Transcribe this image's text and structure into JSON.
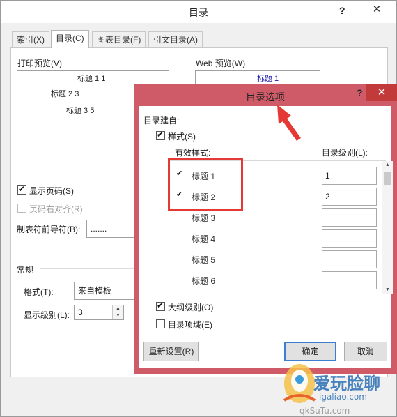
{
  "outer_dialog": {
    "title": "目录",
    "help_label": "?",
    "close_label": "✕",
    "tabs": [
      {
        "label": "索引(X)"
      },
      {
        "label": "目录(C)"
      },
      {
        "label": "图表目录(F)"
      },
      {
        "label": "引文目录(A)"
      }
    ],
    "print_preview": {
      "label": "打印预览(V)",
      "lines": [
        "标题 1 1",
        "标题 2 3",
        "标题 3 5"
      ]
    },
    "web_preview": {
      "label": "Web 预览(W)",
      "lines": [
        "标题 1"
      ]
    },
    "show_page_numbers": {
      "label": "显示页码(S)",
      "checked": true
    },
    "right_align": {
      "label": "页码右对齐(R)",
      "checked": false
    },
    "tab_leader": {
      "label": "制表符前导符(B):",
      "value": "......."
    },
    "general": {
      "heading": "常规",
      "format_label": "格式(T):",
      "format_value": "来自模板",
      "levels_label": "显示级别(L):",
      "levels_value": "3"
    }
  },
  "options_dialog": {
    "title": "目录选项",
    "help_label": "?",
    "close_label": "✕",
    "build_from": "目录建自:",
    "styles_checkbox": {
      "label": "样式(S)",
      "checked": true
    },
    "available_styles_header": "有效样式:",
    "level_header": "目录级别(L):",
    "rows": [
      {
        "check": "✔",
        "name": "标题 1",
        "level": "1"
      },
      {
        "check": "✔",
        "name": "标题 2",
        "level": "2"
      },
      {
        "check": "",
        "name": "标题 3",
        "level": ""
      },
      {
        "check": "",
        "name": "标题 4",
        "level": ""
      },
      {
        "check": "",
        "name": "标题 5",
        "level": ""
      },
      {
        "check": "",
        "name": "标题 6",
        "level": ""
      }
    ],
    "outline_checkbox": {
      "label": "大纲级别(O)",
      "checked": true
    },
    "fields_checkbox": {
      "label": "目录项域(E)",
      "checked": false
    },
    "reset_button": "重新设置(R)",
    "ok_button": "确定",
    "cancel_button": "取消"
  },
  "watermark": {
    "line1": "爱玩脸聊",
    "line2": "igaliao.com",
    "line3": "qkSuTu.com"
  },
  "colors": {
    "highlight": "#e53935",
    "inner_frame": "#cf5b68",
    "default_button": "#3c7fd0"
  }
}
